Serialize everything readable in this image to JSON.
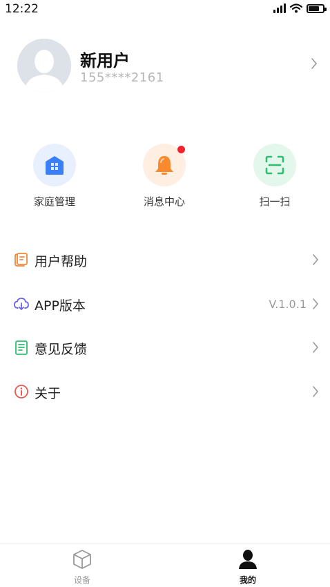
{
  "status_bar": {
    "time": "12:22",
    "battery_level": 0.75,
    "icons": [
      "signal-icon",
      "wifi-icon",
      "battery-icon"
    ]
  },
  "profile": {
    "name": "新用户",
    "phone": "155****2161",
    "avatar_icon": "avatar-placeholder-icon"
  },
  "quick_actions": [
    {
      "label": "家庭管理",
      "icon": "home-icon",
      "color": "#3a7ff6",
      "bg": "#e8f0fe"
    },
    {
      "label": "消息中心",
      "icon": "bell-icon",
      "color": "#fb8a2e",
      "bg": "#ffeee2",
      "has_badge": true
    },
    {
      "label": "扫一扫",
      "icon": "scan-icon",
      "color": "#2dbd6e",
      "bg": "#e4f7ec"
    }
  ],
  "menu": [
    {
      "label": "用户帮助",
      "icon": "help-scroll-icon",
      "value": ""
    },
    {
      "label": "APP版本",
      "icon": "cloud-download-icon",
      "value": "V.1.0.1"
    },
    {
      "label": "意见反馈",
      "icon": "feedback-document-icon",
      "value": ""
    },
    {
      "label": "关于",
      "icon": "info-circle-icon",
      "value": ""
    }
  ],
  "tabbar": {
    "tabs": [
      {
        "label": "设备",
        "icon": "cube-icon",
        "active": false
      },
      {
        "label": "我的",
        "icon": "person-icon",
        "active": true
      }
    ],
    "active_color": "#111111",
    "inactive_color": "#999999"
  }
}
